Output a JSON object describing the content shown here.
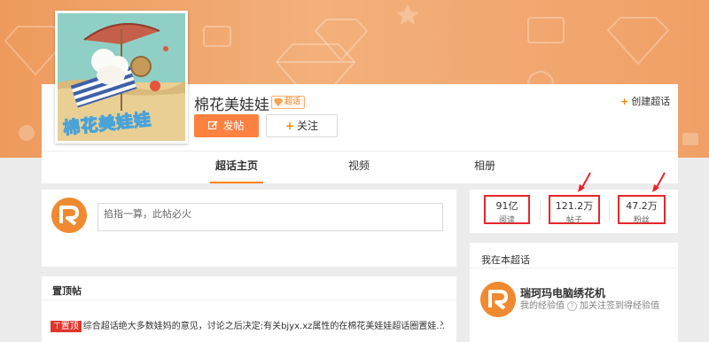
{
  "topic": {
    "title": "棉花美娃娃",
    "badge": "超话",
    "cover_text": "棉花美娃娃"
  },
  "actions": {
    "post_label": "发帖",
    "follow_label": "关注",
    "create_label": "创建超话"
  },
  "tabs": [
    {
      "label": "超话主页",
      "active": true
    },
    {
      "label": "视频",
      "active": false
    },
    {
      "label": "相册",
      "active": false
    }
  ],
  "composer": {
    "placeholder": "掐指一算，此帖必火"
  },
  "pinned": {
    "heading": "置顶帖",
    "tag": "置顶",
    "text": "综合超话绝大多数娃妈的意见，讨论之后决定:有关bjyx.xz属性的在棉花美娃娃超话圈置娃..."
  },
  "stats": [
    {
      "value": "91亿",
      "label": "阅读"
    },
    {
      "value": "121.2万",
      "label": "帖子"
    },
    {
      "value": "47.2万",
      "label": "粉丝"
    }
  ],
  "my_section": {
    "heading": "我在本超话",
    "user_name": "瑞珂玛电脑绣花机",
    "exp_label": "我的经验值",
    "exp_hint": "加关注签到得经验值"
  },
  "colors": {
    "accent": "#ff8200",
    "post_button": "#ff8140",
    "highlight_box": "#e6262c",
    "banner": "#f3b07b"
  }
}
